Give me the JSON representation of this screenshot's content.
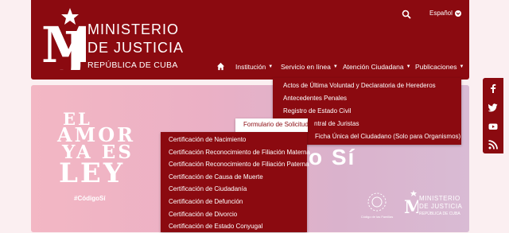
{
  "brand": {
    "line1": "MINISTERIO",
    "line2": "DE JUSTICIA",
    "line3": "REPÚBLICA DE CUBA",
    "color": "#8b0a10"
  },
  "topbar": {
    "language": "Español"
  },
  "nav": {
    "items": [
      {
        "label": "Institución"
      },
      {
        "label": "Servicio en línea"
      },
      {
        "label": "Atención Ciudadana"
      },
      {
        "label": "Publicaciones"
      }
    ]
  },
  "servicio_menu": {
    "items": [
      "Actos de Última Voluntad y Declaratoria de Herederos",
      "Antecedentes Penales",
      "Registro de Estado Civil",
      "ntral de Juristas",
      "Ficha Única del Ciudadano (Solo para Organismos)"
    ]
  },
  "submenu_header": "Formulario de Solicitud",
  "cert_menu": {
    "items": [
      "Certificación de Nacimiento",
      "Certificación Reconocimiento de Filiación Materna",
      "Certificación Reconocimiento de Filiación Paterna",
      "Certificación de Causa de Muerte",
      "Certificación de Ciudadanía",
      "Certificación de Defunción",
      "Certificación de Divorcio",
      "Certificación de Estado Conyugal"
    ]
  },
  "hero": {
    "line_el": "EL",
    "line_amor": "AMOR",
    "line_yaes": "YA ES",
    "line_ley": "LEY",
    "hashtag": "#CódigoSí",
    "right_text": "o Sí",
    "emblem_text": "Código de las Familias",
    "small_logo_l1": "MINISTERIO",
    "small_logo_l2": "DE JUSTICIA",
    "small_logo_l3": "REPÚBLICA DE CUBA"
  },
  "social": [
    "facebook-icon",
    "twitter-icon",
    "youtube-icon",
    "rss-icon"
  ]
}
